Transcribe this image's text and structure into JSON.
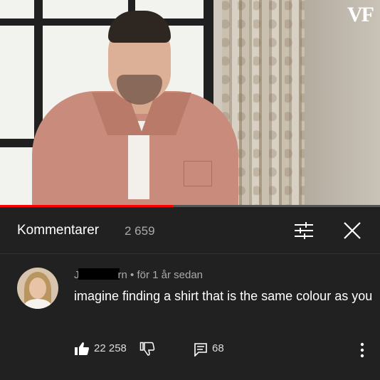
{
  "video": {
    "watermark": "VF",
    "progress_fraction": 0.455,
    "colors": {
      "progress": "#ff0000",
      "shirt": "#c98c7c"
    }
  },
  "comments_panel": {
    "title": "Kommentarer",
    "count": "2 659",
    "icons": {
      "filter": "filter-sliders-icon",
      "close": "close-icon"
    }
  },
  "comment": {
    "author_start": "J",
    "author_end": "rn",
    "separator": "•",
    "time": "för 1 år sedan",
    "text": "imagine finding a shirt that is the same colour as you",
    "likes": "22 258",
    "replies": "68",
    "icons": {
      "like": "thumbs-up-icon",
      "dislike": "thumbs-down-icon",
      "reply": "reply-icon",
      "more": "more-vertical-icon"
    }
  },
  "colors": {
    "background": "#212121",
    "secondary_text": "#aaaaaa",
    "primary_text": "#ffffff"
  }
}
